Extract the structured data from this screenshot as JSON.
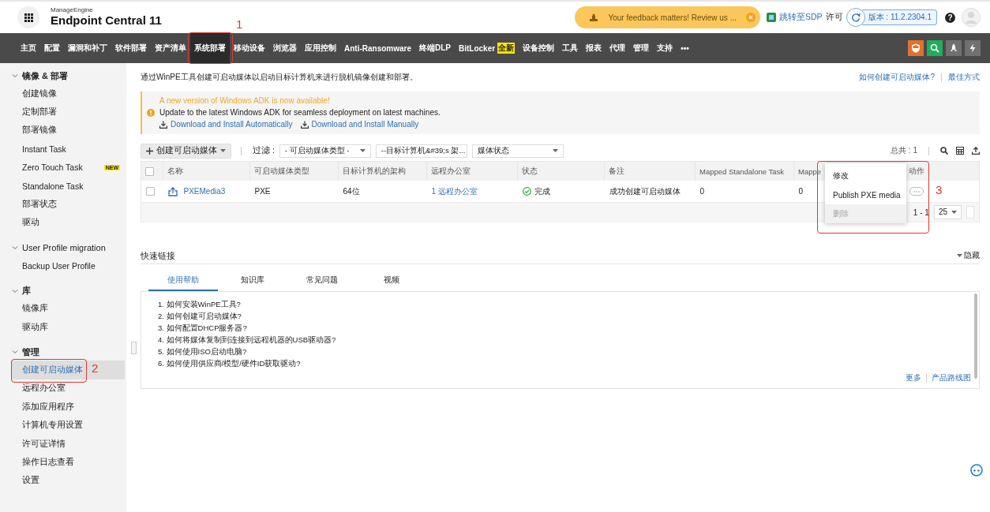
{
  "header": {
    "brand": "ManageEngine",
    "product": "Endpoint Central 11",
    "feedback": "Your feedback matters! Review us ...",
    "sdp_link": "跳转至SDP",
    "license": "许可",
    "version": "版本 : 11.2.2304.1",
    "help": "?"
  },
  "nav": {
    "items": [
      {
        "label": "主页",
        "selected": false
      },
      {
        "label": "配置",
        "selected": false
      },
      {
        "label": "漏洞和补丁",
        "selected": false
      },
      {
        "label": "软件部署",
        "selected": false
      },
      {
        "label": "资产清单",
        "selected": false
      },
      {
        "label": "系统部署",
        "selected": true
      },
      {
        "label": "移动设备",
        "selected": false
      },
      {
        "label": "浏览器",
        "selected": false
      },
      {
        "label": "应用控制",
        "selected": false
      },
      {
        "label": "Anti-Ransomware",
        "selected": false
      },
      {
        "label": "终端DLP",
        "selected": false
      },
      {
        "label": "BitLocker",
        "selected": false,
        "badge": "全新"
      },
      {
        "label": "设备控制",
        "selected": false
      },
      {
        "label": "工具",
        "selected": false
      },
      {
        "label": "报表",
        "selected": false
      },
      {
        "label": "代理",
        "selected": false
      },
      {
        "label": "管理",
        "selected": false
      },
      {
        "label": "支持",
        "selected": false
      },
      {
        "label": "•••",
        "selected": false
      }
    ]
  },
  "sidebar": {
    "sections": [
      {
        "title": "镜像 & 部署",
        "expanded": true,
        "children": [
          {
            "label": "创建镜像",
            "selected": false
          },
          {
            "label": "定制部署",
            "selected": false
          },
          {
            "label": "部署镜像",
            "selected": false
          },
          {
            "label": "Instant Task",
            "selected": false
          },
          {
            "label": "Zero Touch Task",
            "selected": false,
            "badge": "NEW"
          },
          {
            "label": "Standalone Task",
            "selected": false
          },
          {
            "label": "部署状态",
            "selected": false
          },
          {
            "label": "驱动",
            "selected": false
          }
        ]
      },
      {
        "title": "User Profile migration",
        "expanded": true,
        "children": [
          {
            "label": "Backup User Profile",
            "selected": false
          }
        ]
      },
      {
        "title": "库",
        "expanded": true,
        "children": [
          {
            "label": "镜像库",
            "selected": false
          },
          {
            "label": "驱动库",
            "selected": false
          }
        ]
      },
      {
        "title": "管理",
        "expanded": true,
        "children": [
          {
            "label": "创建可启动媒体",
            "selected": true
          },
          {
            "label": "远程办公室",
            "selected": false
          },
          {
            "label": "添加应用程序",
            "selected": false
          },
          {
            "label": "计算机专用设置",
            "selected": false
          },
          {
            "label": "许可证详情",
            "selected": false
          },
          {
            "label": "操作日志查看",
            "selected": false
          },
          {
            "label": "设置",
            "selected": false
          }
        ]
      }
    ]
  },
  "description": "通过WinPE工具创建可启动媒体以启动目标计算机来进行脱机镜像创建和部署。",
  "help_links": [
    "如何创建可启动媒体?",
    "最佳方式"
  ],
  "notice": {
    "title": "A new version of Windows ADK is now available!",
    "message": "Update to the latest Windows ADK for seamless deployment on latest machines.",
    "links": [
      "Download and Install Automatically",
      "Download and Install Manually"
    ]
  },
  "toolbar": {
    "create_button": "创建可启动媒体",
    "filter_label": "过滤 :",
    "filters": [
      "- 可启动媒体类型 -",
      "--目标计算机&#39;s 架...",
      "媒体状态"
    ],
    "total": "总共 : 1"
  },
  "table": {
    "select_all": {
      "checked": false
    },
    "columns": [
      "名称",
      "可启动媒体类型",
      "目标计算机的架构",
      "远程办公室",
      "状态",
      "备注",
      "Mapped Standalone Task",
      "Mappe",
      "动作"
    ],
    "rows": [
      {
        "checked": false,
        "cells": [
          "PXEMedia3",
          "PXE",
          "64位",
          "1 远程办公室",
          "完成",
          "成功创建可启动媒体",
          "0",
          "0"
        ]
      }
    ],
    "pagination": {
      "range": "1 - 1",
      "page_size": "25"
    }
  },
  "action_menu": {
    "items": [
      {
        "label": "修改",
        "disabled": false
      },
      {
        "label": "Publish PXE media",
        "disabled": false
      },
      {
        "label": "删除",
        "disabled": true
      }
    ]
  },
  "quick_links": {
    "title": "快速链接",
    "toggle": "隐藏",
    "tabs": [
      {
        "label": "使用帮助",
        "selected": true
      },
      {
        "label": "知识库",
        "selected": false
      },
      {
        "label": "常见问题",
        "selected": false
      },
      {
        "label": "视频",
        "selected": false
      }
    ],
    "items": [
      "1. 如何安装WinPE工具?",
      "2. 如何创建可启动媒体?",
      "3. 如何配置DHCP服务器?",
      "4. 如何将媒体复制到连接到远程机器的USB驱动器?",
      "5. 如何使用ISO启动电脑?",
      "6. 如何使用供应商/模型/硬件ID获取驱动?"
    ],
    "footer_links": [
      "更多",
      "产品路线图"
    ]
  },
  "annotations": [
    {
      "label": "1"
    },
    {
      "label": "2"
    },
    {
      "label": "3"
    }
  ]
}
